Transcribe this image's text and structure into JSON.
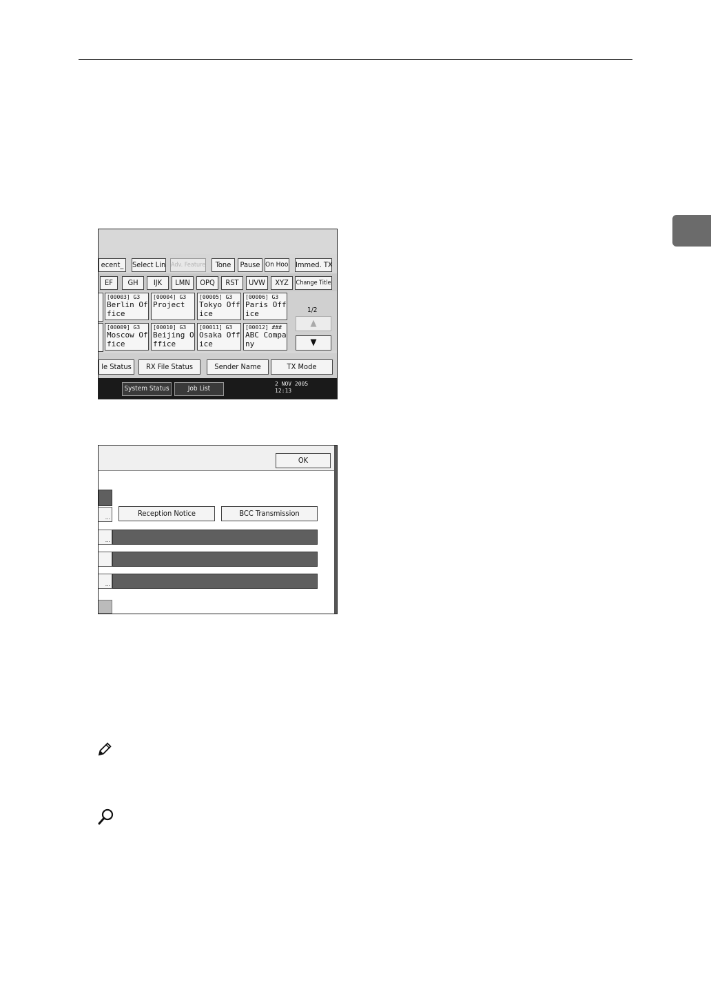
{
  "panel1": {
    "function_keys": [
      "ecent_",
      "Select Line",
      "Adv. Features",
      "Tone",
      "Pause",
      "On Hook",
      "Immed. TX"
    ],
    "tabs": [
      "EF",
      "GH",
      "IJK",
      "LMN",
      "OPQ",
      "RST",
      "UVW",
      "XYZ"
    ],
    "change_title": "Change Title",
    "destinations": [
      {
        "code": "[00003] G3",
        "name": "Berlin Office"
      },
      {
        "code": "[00004] G3",
        "name": "Project"
      },
      {
        "code": "[00005] G3",
        "name": "Tokyo Office"
      },
      {
        "code": "[00006] G3",
        "name": "Paris Office"
      },
      {
        "code": "[00009] G3",
        "name": "Moscow Office"
      },
      {
        "code": "[00010] G3",
        "name": "Beijing Office"
      },
      {
        "code": "[00011] G3",
        "name": "Osaka Office"
      },
      {
        "code": "[00012] ###",
        "name": "ABC Company"
      }
    ],
    "page_indicator": "1/2",
    "up_arrow": "▲",
    "down_arrow": "▼",
    "bottom_buttons": [
      "le Status",
      "RX File Status",
      "Sender Name",
      "TX Mode"
    ],
    "system_status": "System Status",
    "job_list": "Job List",
    "date": "2 NOV 2005",
    "time": "12:13"
  },
  "panel2": {
    "ok_label": "OK",
    "reception_notice": "Reception Notice",
    "bcc_transmission": "BCC Transmission"
  }
}
